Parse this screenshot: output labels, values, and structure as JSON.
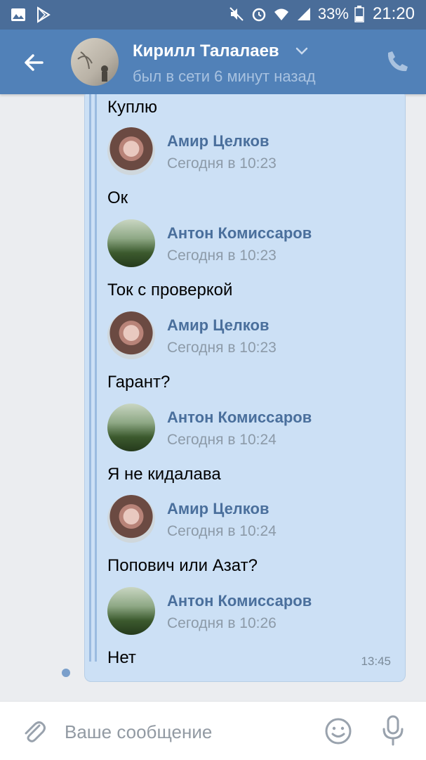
{
  "status_bar": {
    "battery_percent": "33%",
    "time": "21:20",
    "icons": [
      "image-icon",
      "play-store-icon",
      "mute-icon",
      "alarm-icon",
      "wifi-icon",
      "signal-icon",
      "battery-icon"
    ]
  },
  "header": {
    "name": "Кирилл Талалаев",
    "status": "был в сети 6 минут назад",
    "icons": [
      "back-arrow-icon",
      "chevron-down-icon",
      "phone-icon"
    ]
  },
  "chat": {
    "top_message": "Куплю",
    "forwarded": [
      {
        "sender": "Амир Целков",
        "time": "Сегодня в 10:23",
        "text": "Ок",
        "avatar": "amir"
      },
      {
        "sender": "Антон Комиссаров",
        "time": "Сегодня в 10:23",
        "text": "Ток с проверкой",
        "avatar": "anton"
      },
      {
        "sender": "Амир Целков",
        "time": "Сегодня в 10:23",
        "text": "Гарант?",
        "avatar": "amir"
      },
      {
        "sender": "Антон Комиссаров",
        "time": "Сегодня в 10:24",
        "text": "Я не кидалава",
        "avatar": "anton"
      },
      {
        "sender": "Амир Целков",
        "time": "Сегодня в 10:24",
        "text": "Попович или Азат?",
        "avatar": "amir"
      },
      {
        "sender": "Антон Комиссаров",
        "time": "Сегодня в 10:26",
        "text": "Нет",
        "avatar": "anton"
      }
    ],
    "bubble_time": "13:45"
  },
  "composer": {
    "placeholder": "Ваше сообщение",
    "icons": [
      "paperclip-icon",
      "emoji-icon",
      "microphone-icon"
    ]
  },
  "colors": {
    "status_bar": "#4a6d99",
    "header": "#5181b8",
    "bubble": "#cce0f5",
    "sender_name": "#4a6f9c"
  }
}
